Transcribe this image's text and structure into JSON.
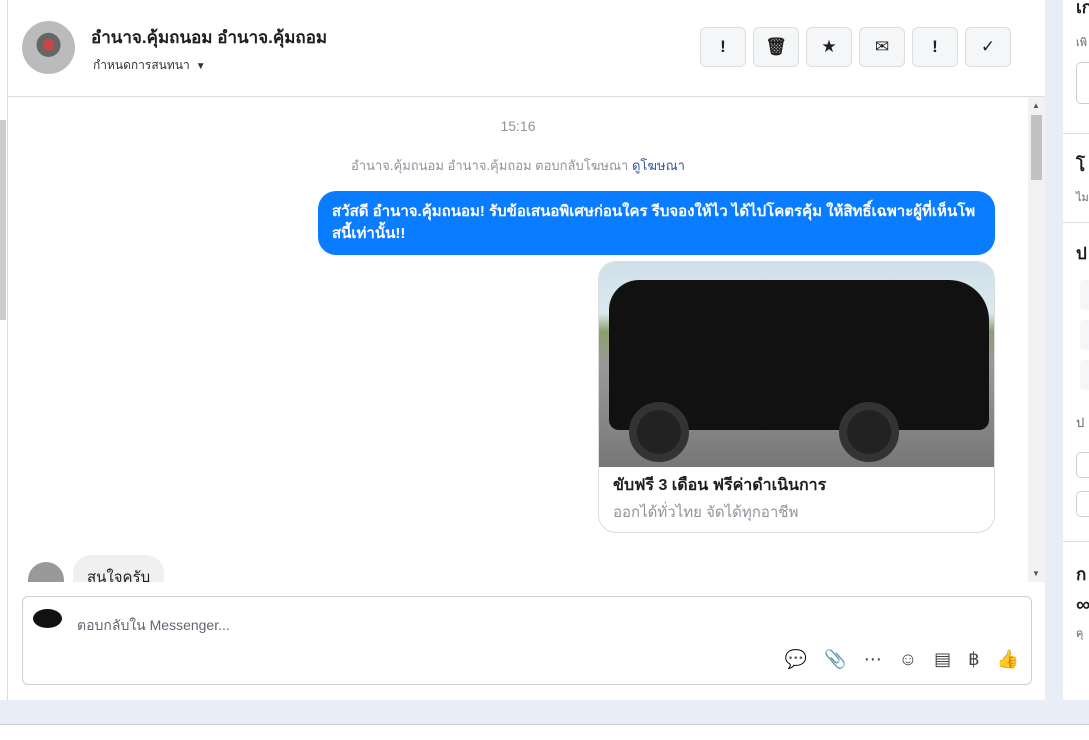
{
  "header": {
    "name": "อำนาจ.คุ้มถนอม อำนาจ.คุ้มถอม",
    "assign_label": "กำหนดการสนทนา",
    "actions": [
      {
        "icon": "alert-circle-icon",
        "glyph": "!"
      },
      {
        "icon": "trash-icon",
        "glyph": "🗑"
      },
      {
        "icon": "star-icon",
        "glyph": "★"
      },
      {
        "icon": "envelope-icon",
        "glyph": "✉"
      },
      {
        "icon": "exclamation-icon",
        "glyph": "!"
      },
      {
        "icon": "check-icon",
        "glyph": "✓"
      }
    ]
  },
  "chat": {
    "time": "15:16",
    "reply_note": "อำนาจ.คุ้มถนอม อำนาจ.คุ้มถอม ตอบกลับโฆษณา",
    "view_ad": "ดูโฆษณา",
    "message": "สวัสดี อำนาจ.คุ้มถนอม! รับข้อเสนอพิเศษก่อนใคร รีบจองให้ไว ได้ไปโคตรคุ้ม ให้สิทธิ์เฉพาะผู้ที่เห็นโพสนี้เท่านั้น!!",
    "card_title": "ขับฟรี 3 เดือน ฟรีค่าดำเนินการ",
    "card_subtitle": "ออกได้ทั่วไทย จัดได้ทุกอาชีพ",
    "customer_reply": "สนใจครับ"
  },
  "composer": {
    "placeholder": "ตอบกลับใน Messenger...",
    "tools": [
      {
        "icon": "saved-reply-icon",
        "glyph": "💬"
      },
      {
        "icon": "attachment-icon",
        "glyph": "📎"
      },
      {
        "icon": "chat-dots-icon",
        "glyph": "⋯"
      },
      {
        "icon": "emoji-icon",
        "glyph": "☺"
      },
      {
        "icon": "document-icon",
        "glyph": "▤"
      },
      {
        "icon": "baht-icon",
        "glyph": "฿"
      },
      {
        "icon": "thumbs-up-icon",
        "glyph": "👍"
      }
    ]
  },
  "right": {
    "h1": "เก",
    "s1": "เพิ",
    "h2": "โ",
    "s2": "ไม",
    "h3": "ป",
    "s3": "ป",
    "h4": "ก",
    "s4": "คุ"
  }
}
